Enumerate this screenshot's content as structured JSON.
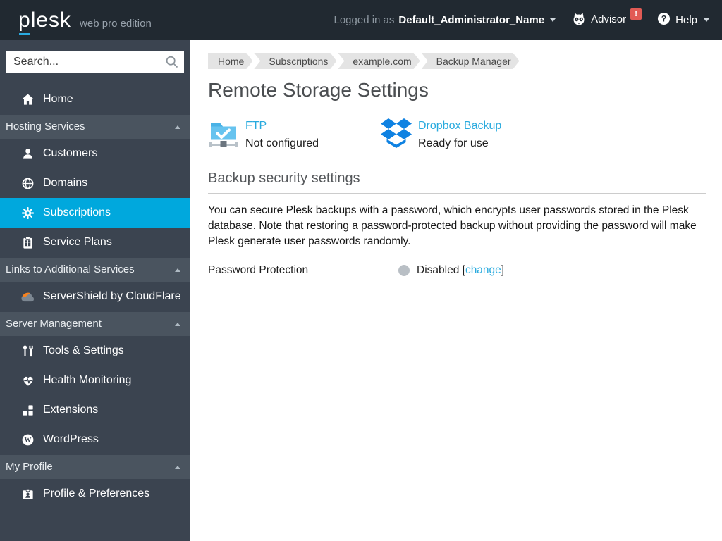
{
  "header": {
    "logo": "plesk",
    "edition": "web pro edition",
    "logged_in_prefix": "Logged in as",
    "user_name": "Default_Administrator_Name",
    "advisor_label": "Advisor",
    "advisor_badge": "!",
    "help_label": "Help"
  },
  "sidebar": {
    "search_placeholder": "Search...",
    "items": [
      {
        "type": "item",
        "label": "Home",
        "icon": "home-icon"
      },
      {
        "type": "group",
        "label": "Hosting Services"
      },
      {
        "type": "item",
        "label": "Customers",
        "icon": "customers-icon"
      },
      {
        "type": "item",
        "label": "Domains",
        "icon": "domains-icon"
      },
      {
        "type": "item",
        "label": "Subscriptions",
        "icon": "subscriptions-icon",
        "active": true
      },
      {
        "type": "item",
        "label": "Service Plans",
        "icon": "service-plans-icon"
      },
      {
        "type": "group",
        "label": "Links to Additional Services"
      },
      {
        "type": "item",
        "label": "ServerShield by CloudFlare",
        "icon": "servershield-icon"
      },
      {
        "type": "group",
        "label": "Server Management"
      },
      {
        "type": "item",
        "label": "Tools & Settings",
        "icon": "tools-settings-icon"
      },
      {
        "type": "item",
        "label": "Health Monitoring",
        "icon": "health-monitoring-icon"
      },
      {
        "type": "item",
        "label": "Extensions",
        "icon": "extensions-icon"
      },
      {
        "type": "item",
        "label": "WordPress",
        "icon": "wordpress-icon"
      },
      {
        "type": "group",
        "label": "My Profile"
      },
      {
        "type": "item",
        "label": "Profile & Preferences",
        "icon": "profile-preferences-icon"
      }
    ]
  },
  "breadcrumb": [
    "Home",
    "Subscriptions",
    "example.com",
    "Backup Manager"
  ],
  "page": {
    "title": "Remote Storage Settings",
    "storages": [
      {
        "name": "FTP",
        "status": "Not configured",
        "icon": "ftp-storage-icon"
      },
      {
        "name": "Dropbox Backup",
        "status": "Ready for use",
        "icon": "dropbox-icon"
      }
    ],
    "security": {
      "heading": "Backup security settings",
      "description": "You can secure Plesk backups with a password, which encrypts user passwords stored in the Plesk database. Note that restoring a password-protected backup without providing the password will make Plesk generate user passwords randomly.",
      "password_label": "Password Protection",
      "password_status": "Disabled",
      "bracket_open": "[",
      "change_link": "change",
      "bracket_close": "]"
    }
  },
  "colors": {
    "header_bg": "#212931",
    "sidebar_bg": "#3b4450",
    "group_bg": "#4a545f",
    "active_item_blue": "#00a8dd",
    "link_blue": "#28aade",
    "badge_red": "#e25b55",
    "breadcrumb_bg": "#e4e4e4",
    "dropbox_blue": "#0f82e2",
    "ftp_folder_blue": "#66c3ef",
    "disabled_indicator_gray": "#b9bfc5"
  }
}
